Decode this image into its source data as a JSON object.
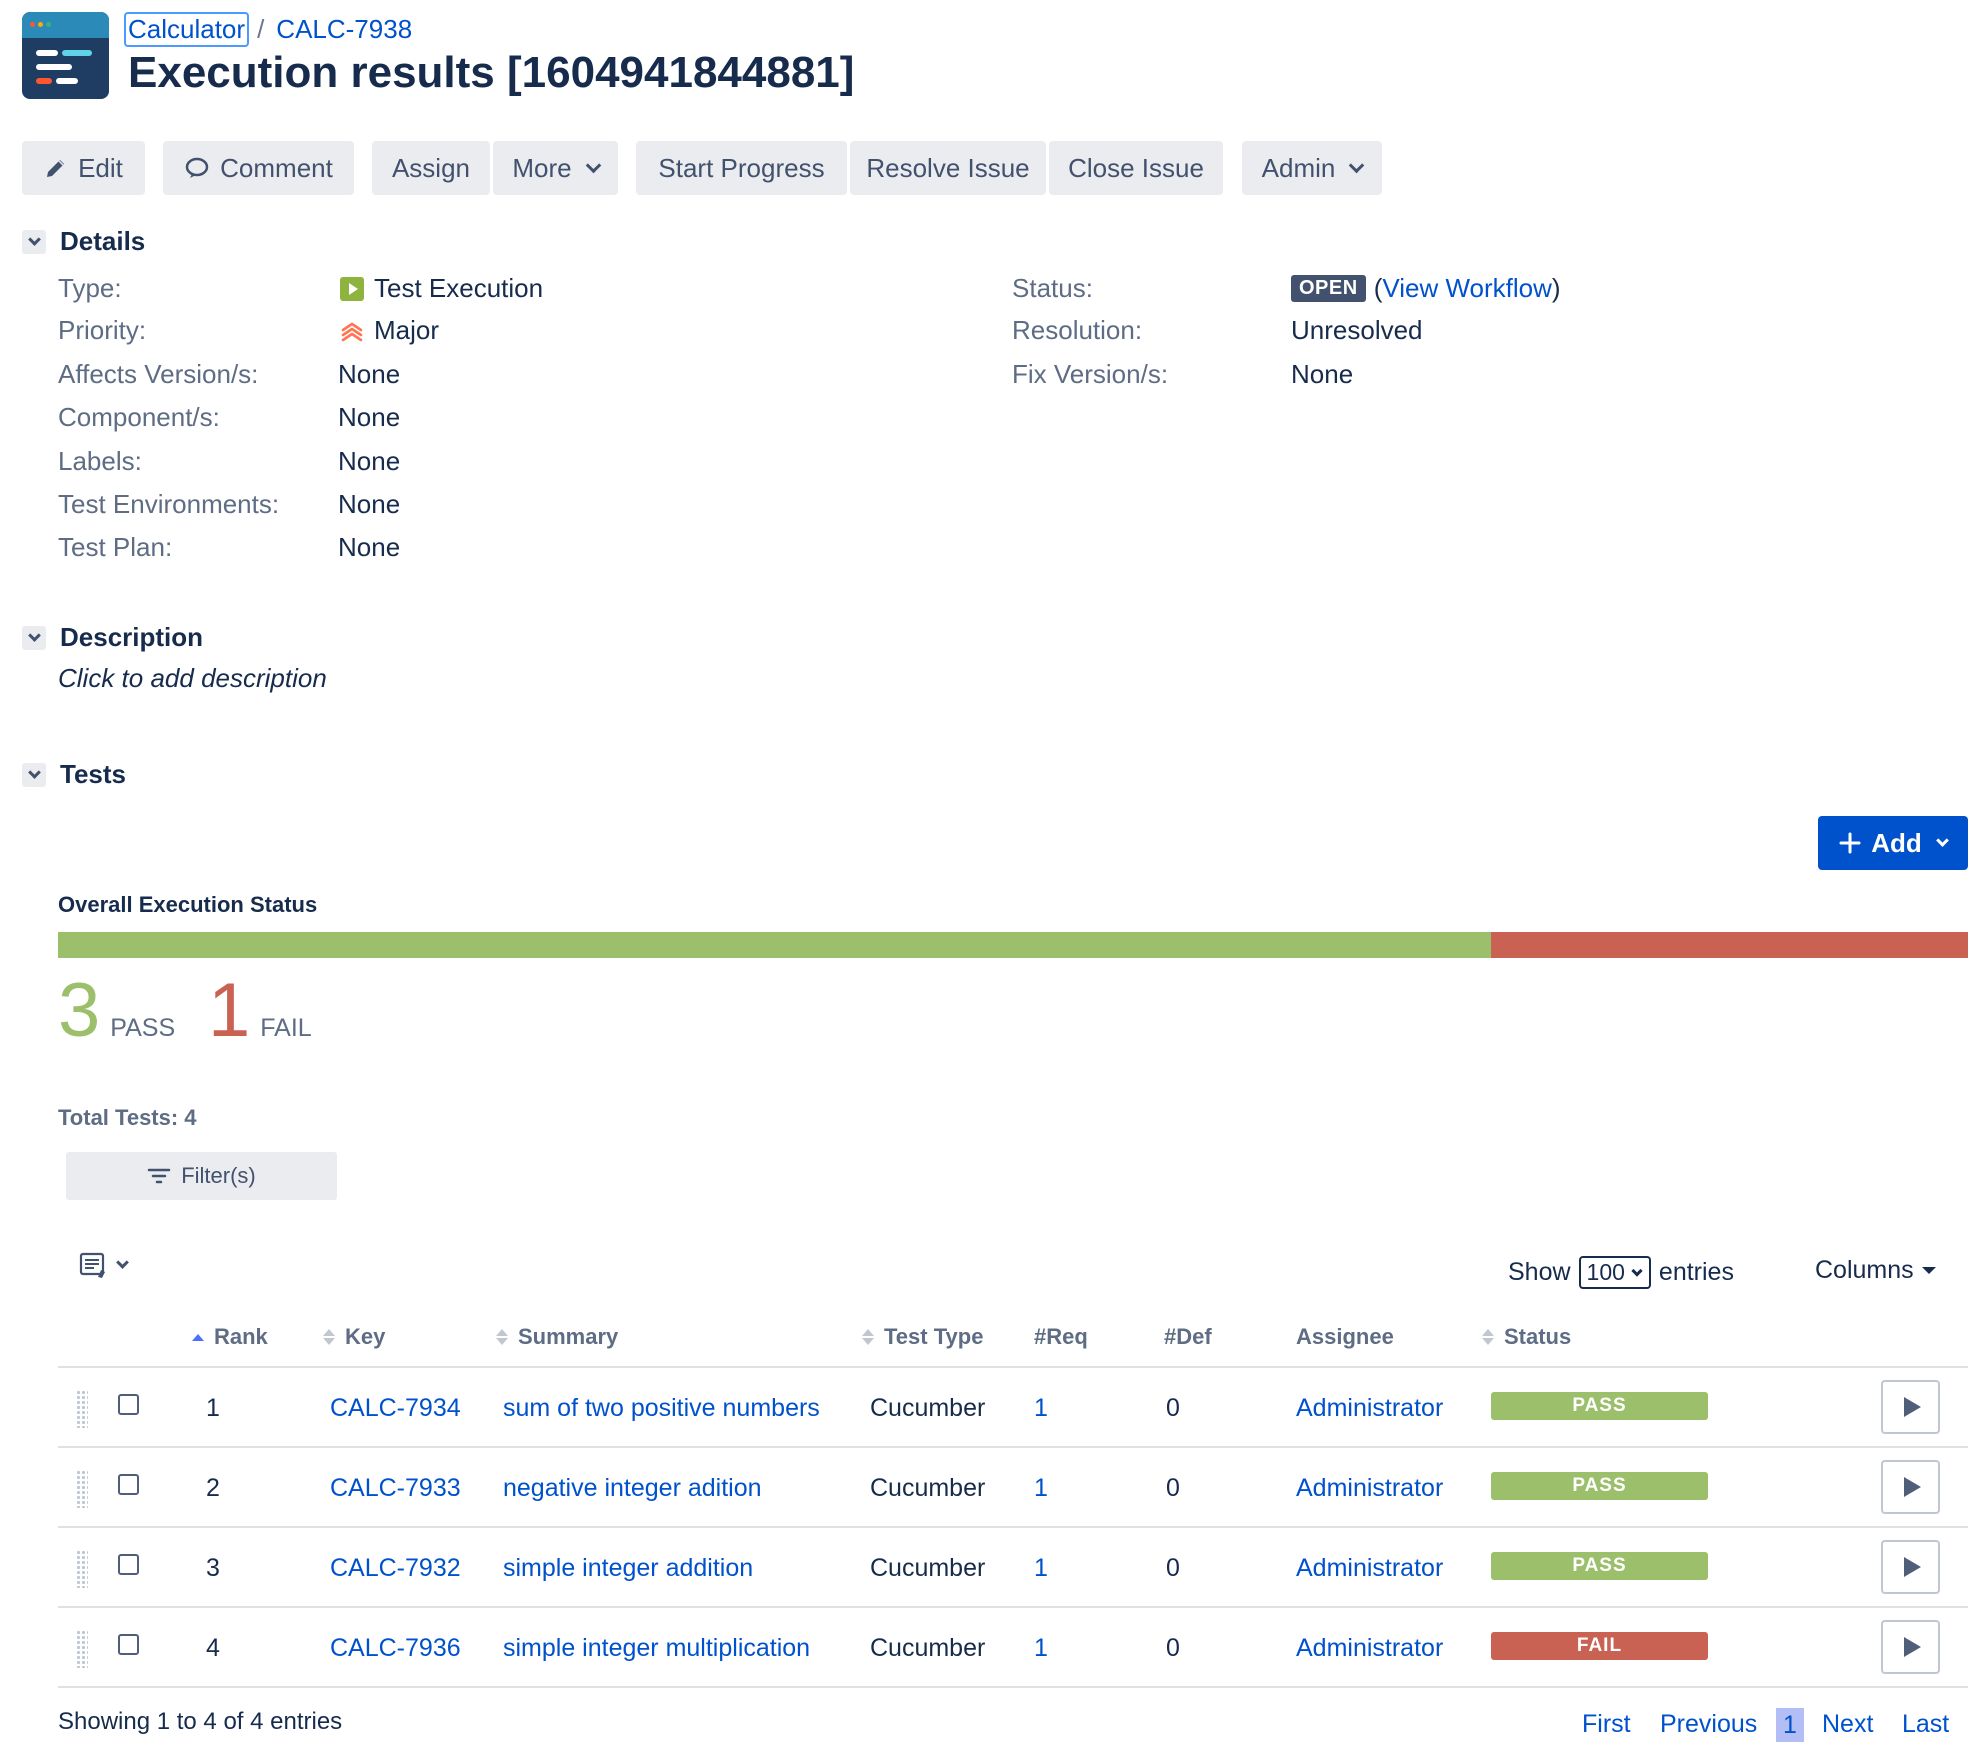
{
  "header": {
    "breadcrumb": {
      "project": "Calculator",
      "separator": "/",
      "issue_key": "CALC-7938"
    },
    "title": "Execution results [1604941844881]"
  },
  "toolbar": {
    "edit": "Edit",
    "comment": "Comment",
    "assign": "Assign",
    "more": "More",
    "start_progress": "Start Progress",
    "resolve_issue": "Resolve Issue",
    "close_issue": "Close Issue",
    "admin": "Admin"
  },
  "details": {
    "heading": "Details",
    "left": [
      {
        "label": "Type:",
        "value": "Test Execution",
        "icon": "test-execution-icon"
      },
      {
        "label": "Priority:",
        "value": "Major",
        "icon": "priority-major-icon"
      },
      {
        "label": "Affects Version/s:",
        "value": "None"
      },
      {
        "label": "Component/s:",
        "value": "None"
      },
      {
        "label": "Labels:",
        "value": "None"
      },
      {
        "label": "Test Environments:",
        "value": "None"
      },
      {
        "label": "Test Plan:",
        "value": "None"
      }
    ],
    "right": {
      "status_label": "Status:",
      "status_lozenge": "OPEN",
      "view_workflow_open": "(",
      "view_workflow": "View Workflow",
      "view_workflow_close": ")",
      "resolution_label": "Resolution:",
      "resolution_value": "Unresolved",
      "fix_label": "Fix Version/s:",
      "fix_value": "None"
    }
  },
  "description": {
    "heading": "Description",
    "placeholder": "Click to add description"
  },
  "tests": {
    "heading": "Tests",
    "add_button": "Add",
    "overall_title": "Overall Execution Status",
    "pass_fraction": 0.75,
    "fail_fraction": 0.25,
    "pass_count": "3",
    "pass_label": "PASS",
    "fail_count": "1",
    "fail_label": "FAIL",
    "total_tests": "Total Tests: 4",
    "filter_button": "Filter(s)",
    "show_label": "Show",
    "show_value": "100",
    "entries_label": "entries",
    "columns_button": "Columns",
    "columns": {
      "rank": "Rank",
      "key": "Key",
      "summary": "Summary",
      "test_type": "Test Type",
      "req": "#Req",
      "def": "#Def",
      "assignee": "Assignee",
      "status": "Status"
    },
    "rows": [
      {
        "rank": "1",
        "key": "CALC-7934",
        "summary": "sum of two positive numbers",
        "test_type": "Cucumber",
        "req": "1",
        "def": "0",
        "assignee": "Administrator",
        "status": "PASS"
      },
      {
        "rank": "2",
        "key": "CALC-7933",
        "summary": "negative integer adition",
        "test_type": "Cucumber",
        "req": "1",
        "def": "0",
        "assignee": "Administrator",
        "status": "PASS"
      },
      {
        "rank": "3",
        "key": "CALC-7932",
        "summary": "simple integer addition",
        "test_type": "Cucumber",
        "req": "1",
        "def": "0",
        "assignee": "Administrator",
        "status": "PASS"
      },
      {
        "rank": "4",
        "key": "CALC-7936",
        "summary": "simple integer multiplication",
        "test_type": "Cucumber",
        "req": "1",
        "def": "0",
        "assignee": "Administrator",
        "status": "FAIL"
      }
    ],
    "footer": "Showing 1 to 4 of 4 entries",
    "pager": {
      "first": "First",
      "previous": "Previous",
      "current": "1",
      "next": "Next",
      "last": "Last"
    }
  },
  "colors": {
    "pass": "#9bbf6b",
    "fail": "#c96253",
    "link": "#0052cc",
    "primary_button": "#0052cc",
    "open_lozenge": "#42526e",
    "priority_major": "#ff7452"
  }
}
